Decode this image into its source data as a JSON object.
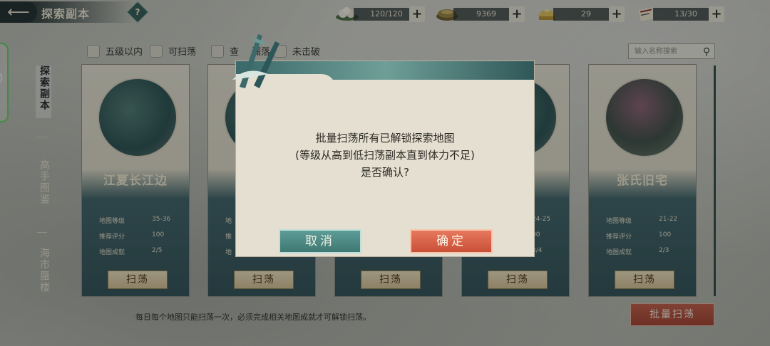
{
  "header": {
    "back_icon": "back-arrow-icon",
    "title": "探索副本",
    "help_label": "?"
  },
  "resources": [
    {
      "icon": "dumpling-icon",
      "value": "120/120"
    },
    {
      "icon": "coins-icon",
      "value": "9369"
    },
    {
      "icon": "ingot-icon",
      "value": "29"
    },
    {
      "icon": "scroll-icon",
      "value": "13/30"
    }
  ],
  "plus_label": "+",
  "side_tabs": [
    "探索副本",
    "高手图鉴",
    "海市蜃楼"
  ],
  "side_handle": "⟩",
  "filters": [
    "五级以内",
    "可扫荡",
    "查",
    "漏落",
    "未击破"
  ],
  "search": {
    "placeholder": "输入名称搜索"
  },
  "cards": [
    {
      "name": "江夏长江边",
      "rows": [
        [
          "地图等级",
          "35-36"
        ],
        [
          "推荐评分",
          "100"
        ],
        [
          "地图成就",
          "2/5"
        ]
      ],
      "button": "扫荡"
    },
    {
      "name": "",
      "rows": [
        [
          "地",
          ""
        ],
        [
          "推",
          ""
        ],
        [
          "地",
          ""
        ]
      ],
      "button": "扫荡"
    },
    {
      "name": "",
      "rows": [
        [
          "",
          ""
        ],
        [
          "",
          ""
        ],
        [
          "",
          ""
        ]
      ],
      "button": "扫荡"
    },
    {
      "name": "",
      "rows": [
        [
          "",
          "24-25"
        ],
        [
          "",
          "00"
        ],
        [
          "",
          "3/4"
        ]
      ],
      "button": "扫荡"
    },
    {
      "name": "张氏旧宅",
      "rows": [
        [
          "地图等级",
          "21-22"
        ],
        [
          "推荐评分",
          "100"
        ],
        [
          "地图成就",
          "2/3"
        ]
      ],
      "button": "扫荡"
    }
  ],
  "tip": "每日每个地图只能扫荡一次，必须完成相关地图成就才可解锁扫荡。",
  "batch_button": "批量扫荡",
  "modal": {
    "line1": "批量扫荡所有已解锁探索地图",
    "line2": "(等级从高到低扫荡副本直到体力不足)",
    "line3": "是否确认?",
    "cancel": "取消",
    "confirm": "确定"
  }
}
